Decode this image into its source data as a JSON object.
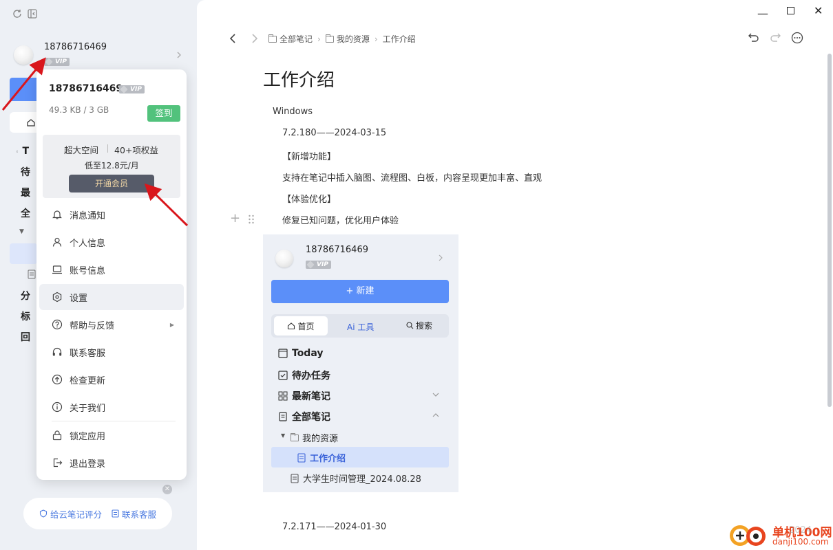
{
  "window": {
    "min_label": "—",
    "max_label": "☐",
    "close_label": "✕"
  },
  "sidebar": {
    "username": "18786716469",
    "vip_label": "VIP",
    "nav_letters": [
      "T",
      "待",
      "最",
      "全",
      "分",
      "标",
      "回"
    ],
    "footer": {
      "rate_label": "给云笔记评分",
      "service_label": "联系客服"
    }
  },
  "popup": {
    "username": "18786716469",
    "vip_label": "VIP",
    "storage": "49.3 KB / 3 GB",
    "checkin_label": "签到",
    "promo": {
      "space": "超大空间",
      "rights": "40+项权益",
      "price": "低至12.8元/月",
      "button": "开通会员"
    },
    "menu": [
      {
        "label": "消息通知",
        "icon": "bell-icon"
      },
      {
        "label": "个人信息",
        "icon": "user-icon"
      },
      {
        "label": "账号信息",
        "icon": "laptop-icon"
      },
      {
        "label": "设置",
        "icon": "settings-icon"
      },
      {
        "label": "帮助与反馈",
        "icon": "help-icon"
      },
      {
        "label": "联系客服",
        "icon": "headset-icon"
      },
      {
        "label": "检查更新",
        "icon": "upgrade-icon"
      },
      {
        "label": "关于我们",
        "icon": "info-icon"
      },
      {
        "label": "锁定应用",
        "icon": "lock-icon"
      },
      {
        "label": "退出登录",
        "icon": "logout-icon"
      }
    ]
  },
  "breadcrumb": {
    "all": "全部笔记",
    "resources": "我的资源",
    "current": "工作介绍"
  },
  "doc": {
    "title": "工作介绍",
    "lines": [
      "Windows",
      "7.2.180——2024-03-15",
      "【新增功能】",
      "支持在笔记中插入脑图、流程图、白板，内容呈现更加丰富、直观",
      "【体验优化】",
      "修复已知问题，优化用户体验",
      "7.2.171——2024-01-30"
    ]
  },
  "embed": {
    "username": "18786716469",
    "vip_label": "VIP",
    "new_button": "+ 新建",
    "tabs": [
      "首页",
      "Ai 工具",
      "搜索"
    ],
    "items": [
      "Today",
      "待办任务",
      "最新笔记",
      "全部笔记",
      "我的资源",
      "工作介绍",
      "大学生时间管理_2024.08.28"
    ]
  },
  "watermark": {
    "site": "单机100网",
    "url": "danji100.com",
    "partial": "2024"
  },
  "colors": {
    "accent": "#5b8ff9",
    "checkin": "#52c27c",
    "arrow": "#d9161c",
    "promo_button": "#565b69"
  }
}
